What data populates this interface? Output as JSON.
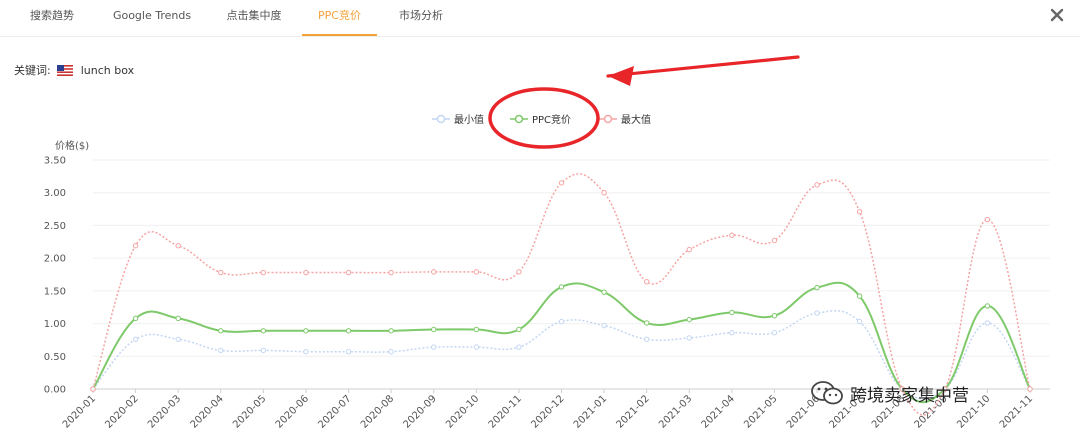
{
  "tabs": [
    {
      "label": "搜索趋势",
      "active": false
    },
    {
      "label": "Google Trends",
      "active": false
    },
    {
      "label": "点击集中度",
      "active": false
    },
    {
      "label": "PPC竞价",
      "active": true
    },
    {
      "label": "市场分析",
      "active": false
    }
  ],
  "keyword": {
    "label": "关键词:",
    "value": "lunch box"
  },
  "watermark": "跨境卖家集中营",
  "chart_data": {
    "type": "line",
    "ylabel": "价格($)",
    "ylim": [
      0,
      3.5
    ],
    "yticks": [
      "0.00",
      "0.50",
      "1.00",
      "1.50",
      "2.00",
      "2.50",
      "3.00",
      "3.50"
    ],
    "categories": [
      "2020-01",
      "2020-02",
      "2020-03",
      "2020-04",
      "2020-05",
      "2020-06",
      "2020-07",
      "2020-08",
      "2020-09",
      "2020-10",
      "2020-11",
      "2020-12",
      "2021-01",
      "2021-02",
      "2021-03",
      "2021-04",
      "2021-05",
      "2021-06",
      "2021-07",
      "2021-08",
      "2021-09",
      "2021-10",
      "2021-11"
    ],
    "legend_position": "top-center",
    "series": [
      {
        "name": "最小值",
        "color": "#c3d6f2",
        "dashed": true,
        "values": [
          0,
          0.76,
          0.76,
          0.59,
          0.59,
          0.57,
          0.57,
          0.57,
          0.64,
          0.64,
          0.64,
          1.03,
          0.97,
          0.76,
          0.78,
          0.86,
          0.86,
          1.16,
          1.03,
          0,
          0,
          1.01,
          0
        ]
      },
      {
        "name": "PPC竞价",
        "color": "#7ec96a",
        "dashed": false,
        "values": [
          0,
          1.08,
          1.08,
          0.89,
          0.89,
          0.89,
          0.89,
          0.89,
          0.91,
          0.91,
          0.91,
          1.56,
          1.48,
          1.01,
          1.06,
          1.17,
          1.12,
          1.55,
          1.42,
          0,
          0,
          1.27,
          0
        ]
      },
      {
        "name": "最大值",
        "color": "#f5a3a3",
        "dashed": true,
        "values": [
          0,
          2.19,
          2.19,
          1.78,
          1.78,
          1.78,
          1.78,
          1.78,
          1.79,
          1.79,
          1.79,
          3.15,
          3.0,
          1.64,
          2.13,
          2.35,
          2.27,
          3.12,
          2.71,
          0,
          0,
          2.59,
          0
        ]
      }
    ]
  }
}
